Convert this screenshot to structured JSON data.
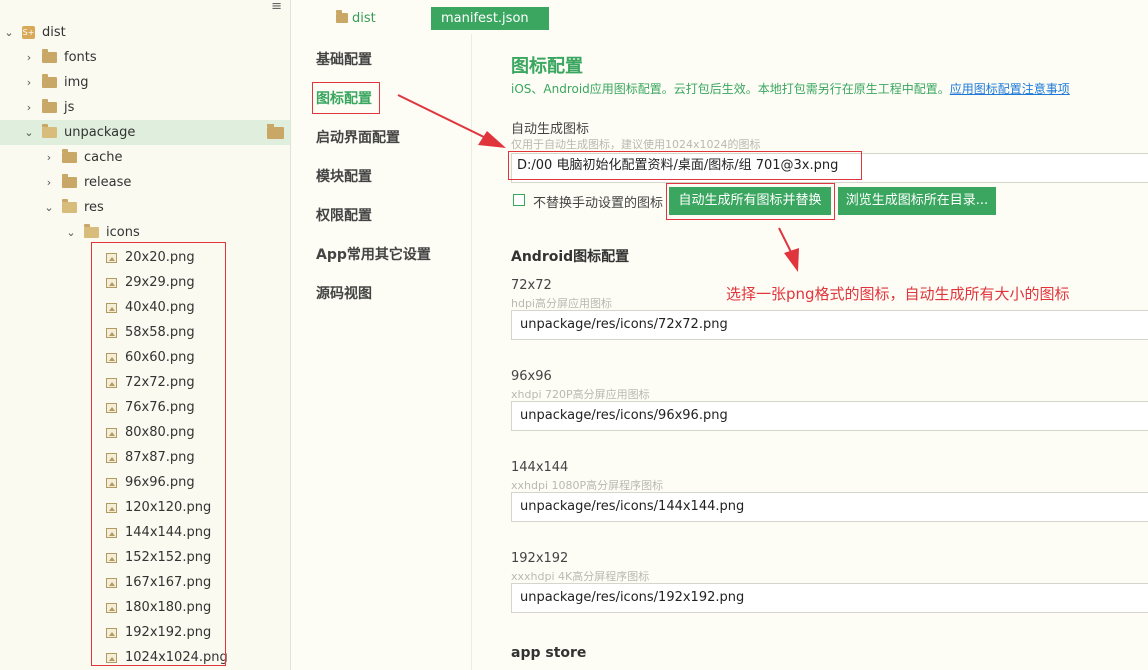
{
  "sidebar": {
    "menu_glyph": "≡",
    "root": {
      "label": "dist",
      "badge": "S+"
    },
    "items": [
      {
        "label": "fonts"
      },
      {
        "label": "img"
      },
      {
        "label": "js"
      },
      {
        "label": "unpackage"
      },
      {
        "label": "cache"
      },
      {
        "label": "release"
      },
      {
        "label": "res"
      },
      {
        "label": "icons"
      }
    ],
    "files": [
      "20x20.png",
      "29x29.png",
      "40x40.png",
      "58x58.png",
      "60x60.png",
      "72x72.png",
      "76x76.png",
      "80x80.png",
      "87x87.png",
      "96x96.png",
      "120x120.png",
      "144x144.png",
      "152x152.png",
      "167x167.png",
      "180x180.png",
      "192x192.png",
      "1024x1024.png"
    ]
  },
  "tabs": {
    "dist": "dist",
    "manifest": "manifest.json"
  },
  "nav": {
    "items": [
      "基础配置",
      "图标配置",
      "启动界面配置",
      "模块配置",
      "权限配置",
      "App常用其它设置",
      "源码视图"
    ],
    "active": "图标配置"
  },
  "main": {
    "title": "图标配置",
    "desc": "iOS、Android应用图标配置。云打包后生效。本地打包需另行在原生工程中配置。",
    "desc_link": "应用图标配置注意事项",
    "auto": {
      "label": "自动生成图标",
      "hint": "仅用于自动生成图标，建议使用1024x1024的图标",
      "value": "D:/00 电脑初始化配置资料/桌面/图标/组 701@3x.png",
      "checkbox_label": "不替换手动设置的图标",
      "gen_button": "自动生成所有图标并替换",
      "browse_button": "浏览生成图标所在目录..."
    },
    "android": {
      "title": "Android图标配置",
      "entries": [
        {
          "size": "72x72",
          "hint": "hdpi高分屏应用图标",
          "value": "unpackage/res/icons/72x72.png"
        },
        {
          "size": "96x96",
          "hint": "xhdpi 720P高分屏应用图标",
          "value": "unpackage/res/icons/96x96.png"
        },
        {
          "size": "144x144",
          "hint": "xxhdpi 1080P高分屏程序图标",
          "value": "unpackage/res/icons/144x144.png"
        },
        {
          "size": "192x192",
          "hint": "xxxhdpi 4K高分屏程序图标",
          "value": "unpackage/res/icons/192x192.png"
        }
      ]
    },
    "appstore_title": "app store",
    "annotation": "选择一张png格式的图标，自动生成所有大小的图标"
  },
  "colors": {
    "accent": "#3aa660",
    "annotation": "#e0353d",
    "link": "#1e7ad6"
  }
}
